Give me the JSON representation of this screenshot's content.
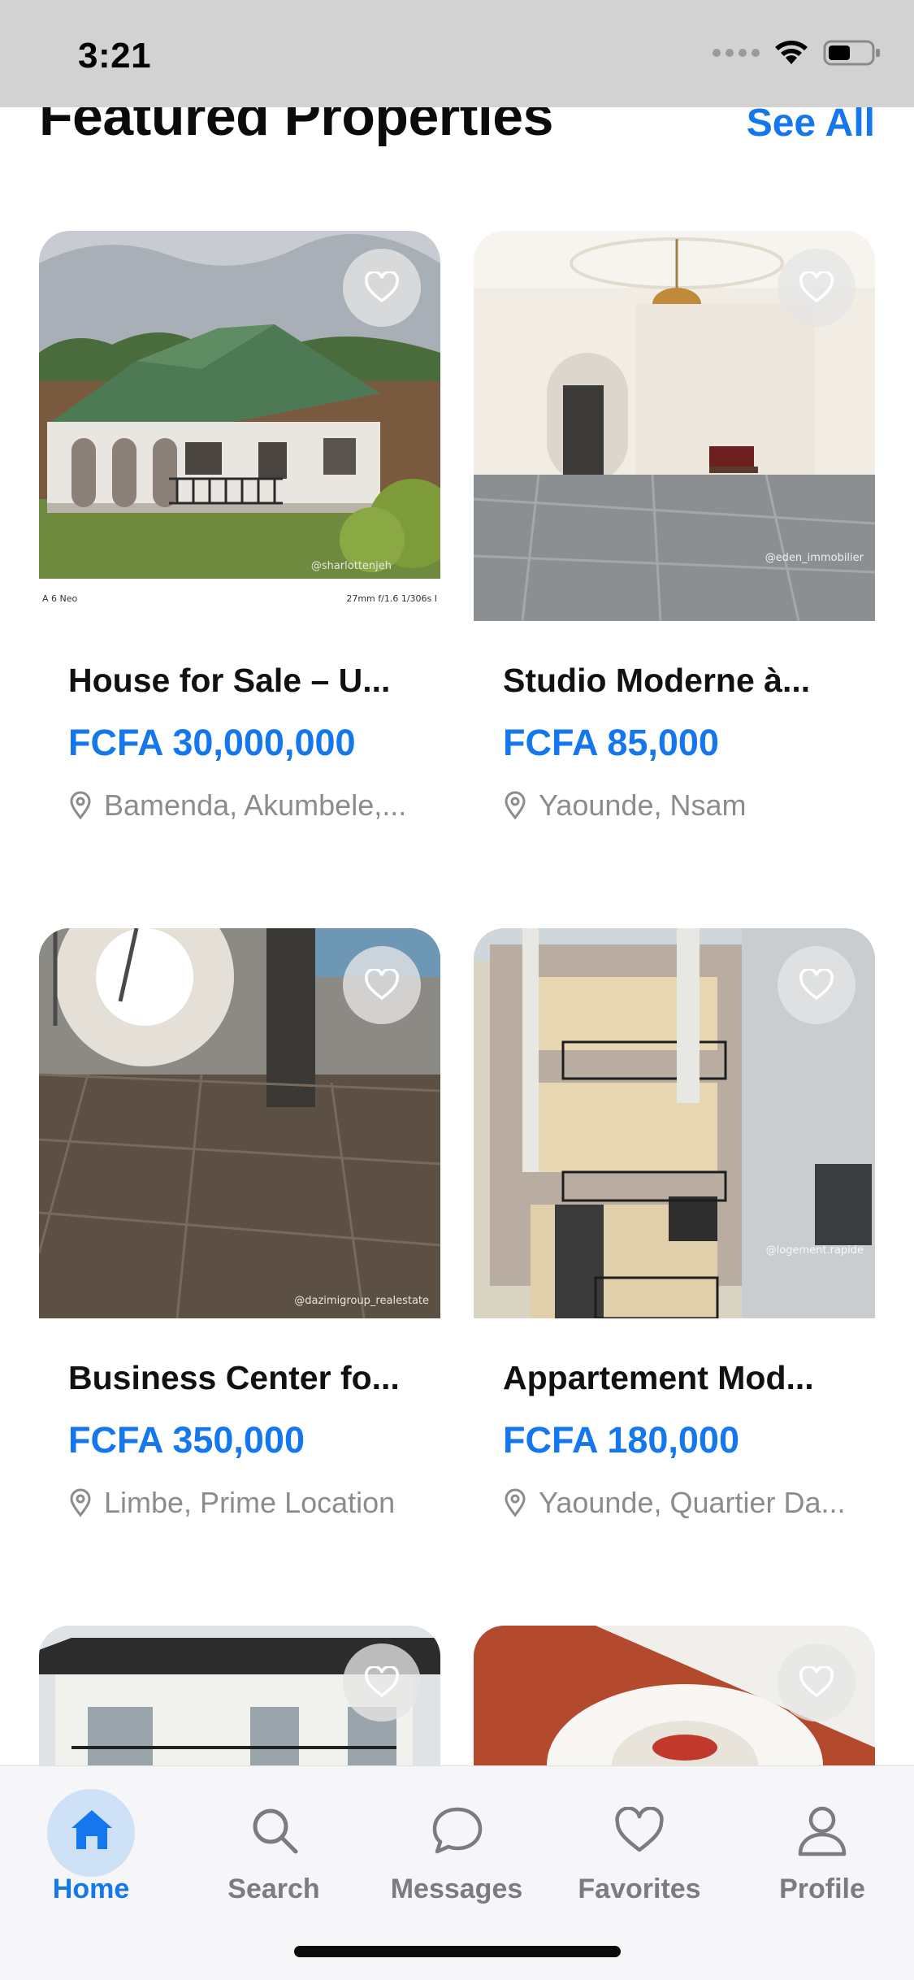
{
  "status_bar": {
    "time": "3:21"
  },
  "header": {
    "title": "Featured Properties",
    "see_all": "See All"
  },
  "listings": [
    {
      "title": "House for Sale – U...",
      "price": "FCFA 30,000,000",
      "location": "Bamenda, Akumbele,...",
      "watermark": "@sharlottenjeh",
      "camera_left": "A 6 Neo",
      "camera_right": "27mm f/1.6 1/306s I"
    },
    {
      "title": "Studio Moderne à...",
      "price": "FCFA 85,000",
      "location": "Yaounde, Nsam",
      "watermark": "@eden_immobilier"
    },
    {
      "title": "Business Center fo...",
      "price": "FCFA 350,000",
      "location": "Limbe,  Prime Location",
      "watermark": "@dazimigroup_realestate"
    },
    {
      "title": "Appartement Mod...",
      "price": "FCFA 180,000",
      "location": "Yaounde, Quartier Da...",
      "watermark": "@logement.rapide"
    },
    {
      "title": "",
      "price": "",
      "location": ""
    },
    {
      "title": "",
      "price": "",
      "location": ""
    }
  ],
  "tab_bar": {
    "tabs": [
      {
        "label": "Home",
        "icon": "house-icon",
        "active": true
      },
      {
        "label": "Search",
        "icon": "magnifier-icon",
        "active": false
      },
      {
        "label": "Messages",
        "icon": "chat-bubble-icon",
        "active": false
      },
      {
        "label": "Favorites",
        "icon": "heart-icon",
        "active": false
      },
      {
        "label": "Profile",
        "icon": "person-icon",
        "active": false
      }
    ]
  },
  "colors": {
    "accent": "#1577ee",
    "status_bar_bg": "#d2d2d2",
    "muted_text": "#8c8c8c",
    "home_bubble": "#cfe1f7"
  }
}
